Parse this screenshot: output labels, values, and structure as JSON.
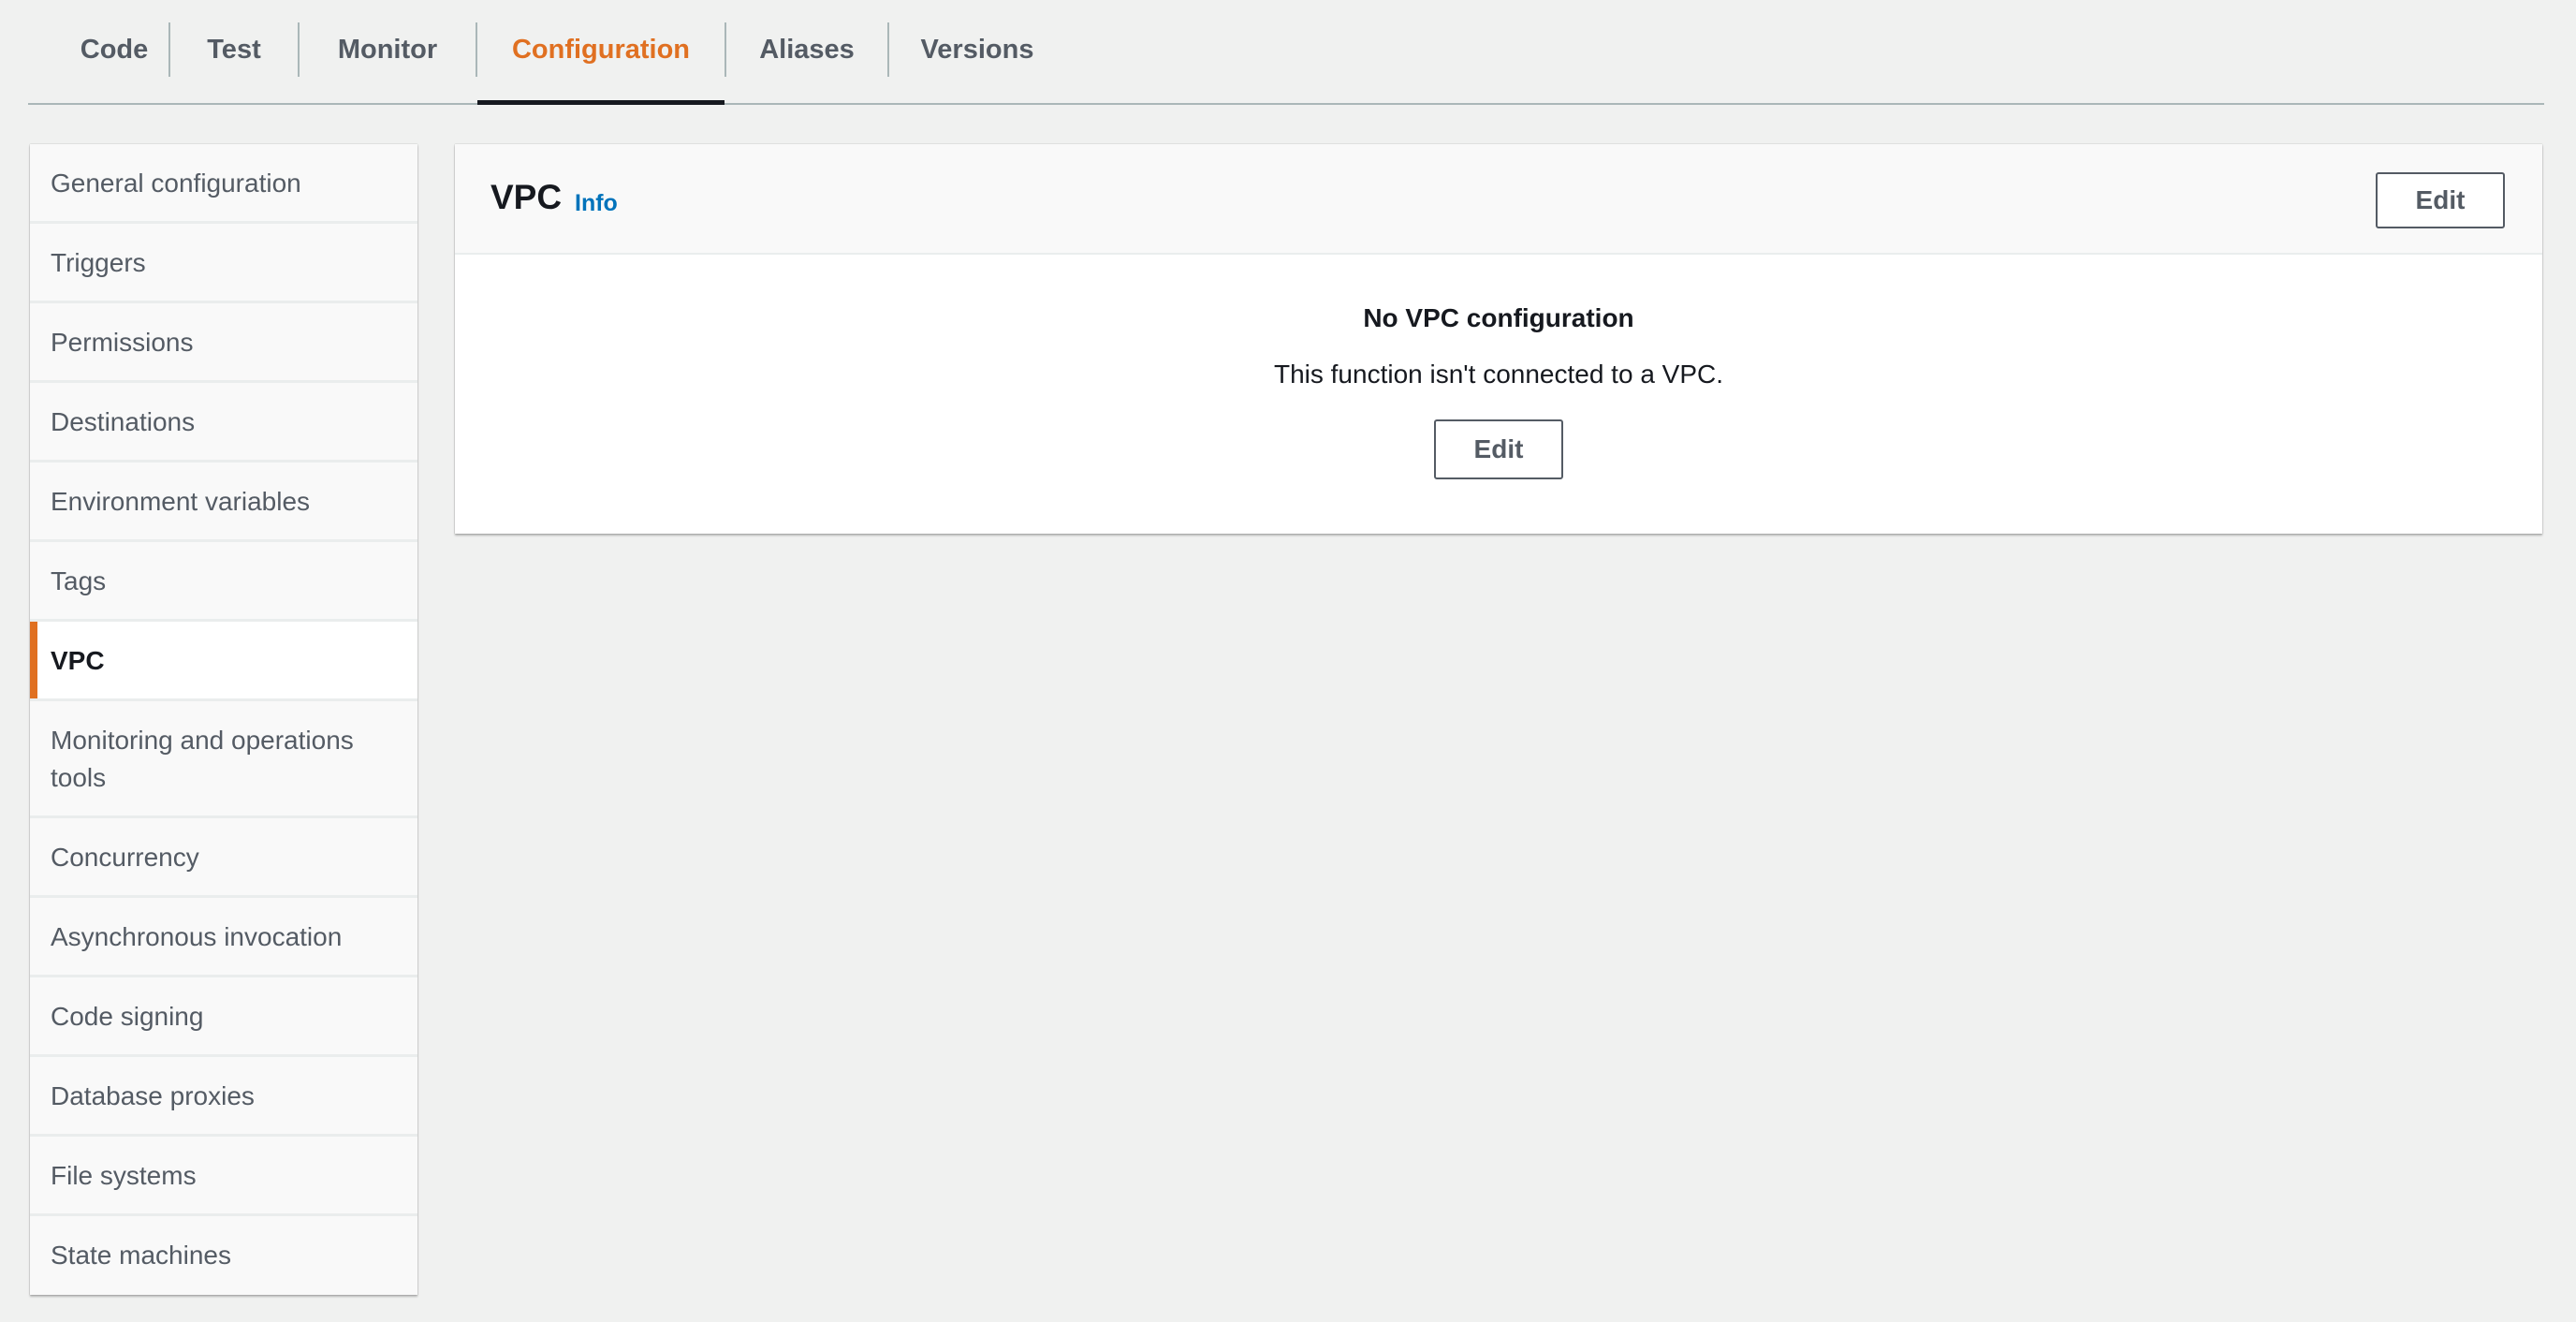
{
  "tabs": [
    {
      "label": "Code"
    },
    {
      "label": "Test"
    },
    {
      "label": "Monitor"
    },
    {
      "label": "Configuration"
    },
    {
      "label": "Aliases"
    },
    {
      "label": "Versions"
    }
  ],
  "active_tab": "Configuration",
  "sidebar": {
    "items": [
      {
        "label": "General configuration"
      },
      {
        "label": "Triggers"
      },
      {
        "label": "Permissions"
      },
      {
        "label": "Destinations"
      },
      {
        "label": "Environment variables"
      },
      {
        "label": "Tags"
      },
      {
        "label": "VPC"
      },
      {
        "label": "Monitoring and operations tools"
      },
      {
        "label": "Concurrency"
      },
      {
        "label": "Asynchronous invocation"
      },
      {
        "label": "Code signing"
      },
      {
        "label": "Database proxies"
      },
      {
        "label": "File systems"
      },
      {
        "label": "State machines"
      }
    ],
    "active_item": "VPC"
  },
  "panel": {
    "title": "VPC",
    "info_label": "Info",
    "edit_label": "Edit",
    "empty_title": "No VPC configuration",
    "empty_description": "This function isn't connected to a VPC.",
    "empty_edit_label": "Edit"
  },
  "colors": {
    "accent": "#e07021",
    "link": "#0073bb",
    "text": "#16191f",
    "muted_text": "#545b64",
    "background": "#f0f1f0"
  }
}
